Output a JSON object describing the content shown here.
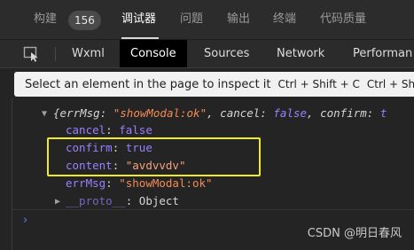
{
  "topbar": {
    "tabs": [
      {
        "label": "构建"
      },
      {
        "label": "调试器"
      },
      {
        "label": "问题"
      },
      {
        "label": "输出"
      },
      {
        "label": "终端"
      },
      {
        "label": "代码质量"
      }
    ],
    "build_count": "156"
  },
  "devtools": {
    "tabs": [
      {
        "label": "Wxml"
      },
      {
        "label": "Console"
      },
      {
        "label": "Sources"
      },
      {
        "label": "Network"
      },
      {
        "label": "Performan"
      }
    ],
    "active_tab": "Console"
  },
  "hint": {
    "text": "Select an element in the page to inspect it",
    "shortcut1": "Ctrl + Shift + C",
    "shortcut2": "Ctrl + Sh"
  },
  "console": {
    "summary": {
      "open": "{",
      "k1": "errMsg",
      "v1": "\"showModal:ok\"",
      "k2": "cancel",
      "v2": "false",
      "k3": "confirm",
      "tail": "t"
    },
    "props": [
      {
        "key": "cancel",
        "value": "false"
      },
      {
        "key": "confirm",
        "value": "true"
      },
      {
        "key": "content",
        "value": "\"avdvvdv\""
      },
      {
        "key": "errMsg",
        "value": "\"showModal:ok\""
      }
    ],
    "proto": {
      "key": "__proto__",
      "value": "Object"
    }
  },
  "watermark": "CSDN @明日春风",
  "colors": {
    "highlight_border": "#f2ea21",
    "key_purple": "#9980ff",
    "string_orange": "#f28b54"
  },
  "icons": {
    "inspect": "element-picker-icon",
    "expand": "triangle-down-icon",
    "collapse": "triangle-right-icon",
    "prompt": "chevron-right-icon"
  }
}
